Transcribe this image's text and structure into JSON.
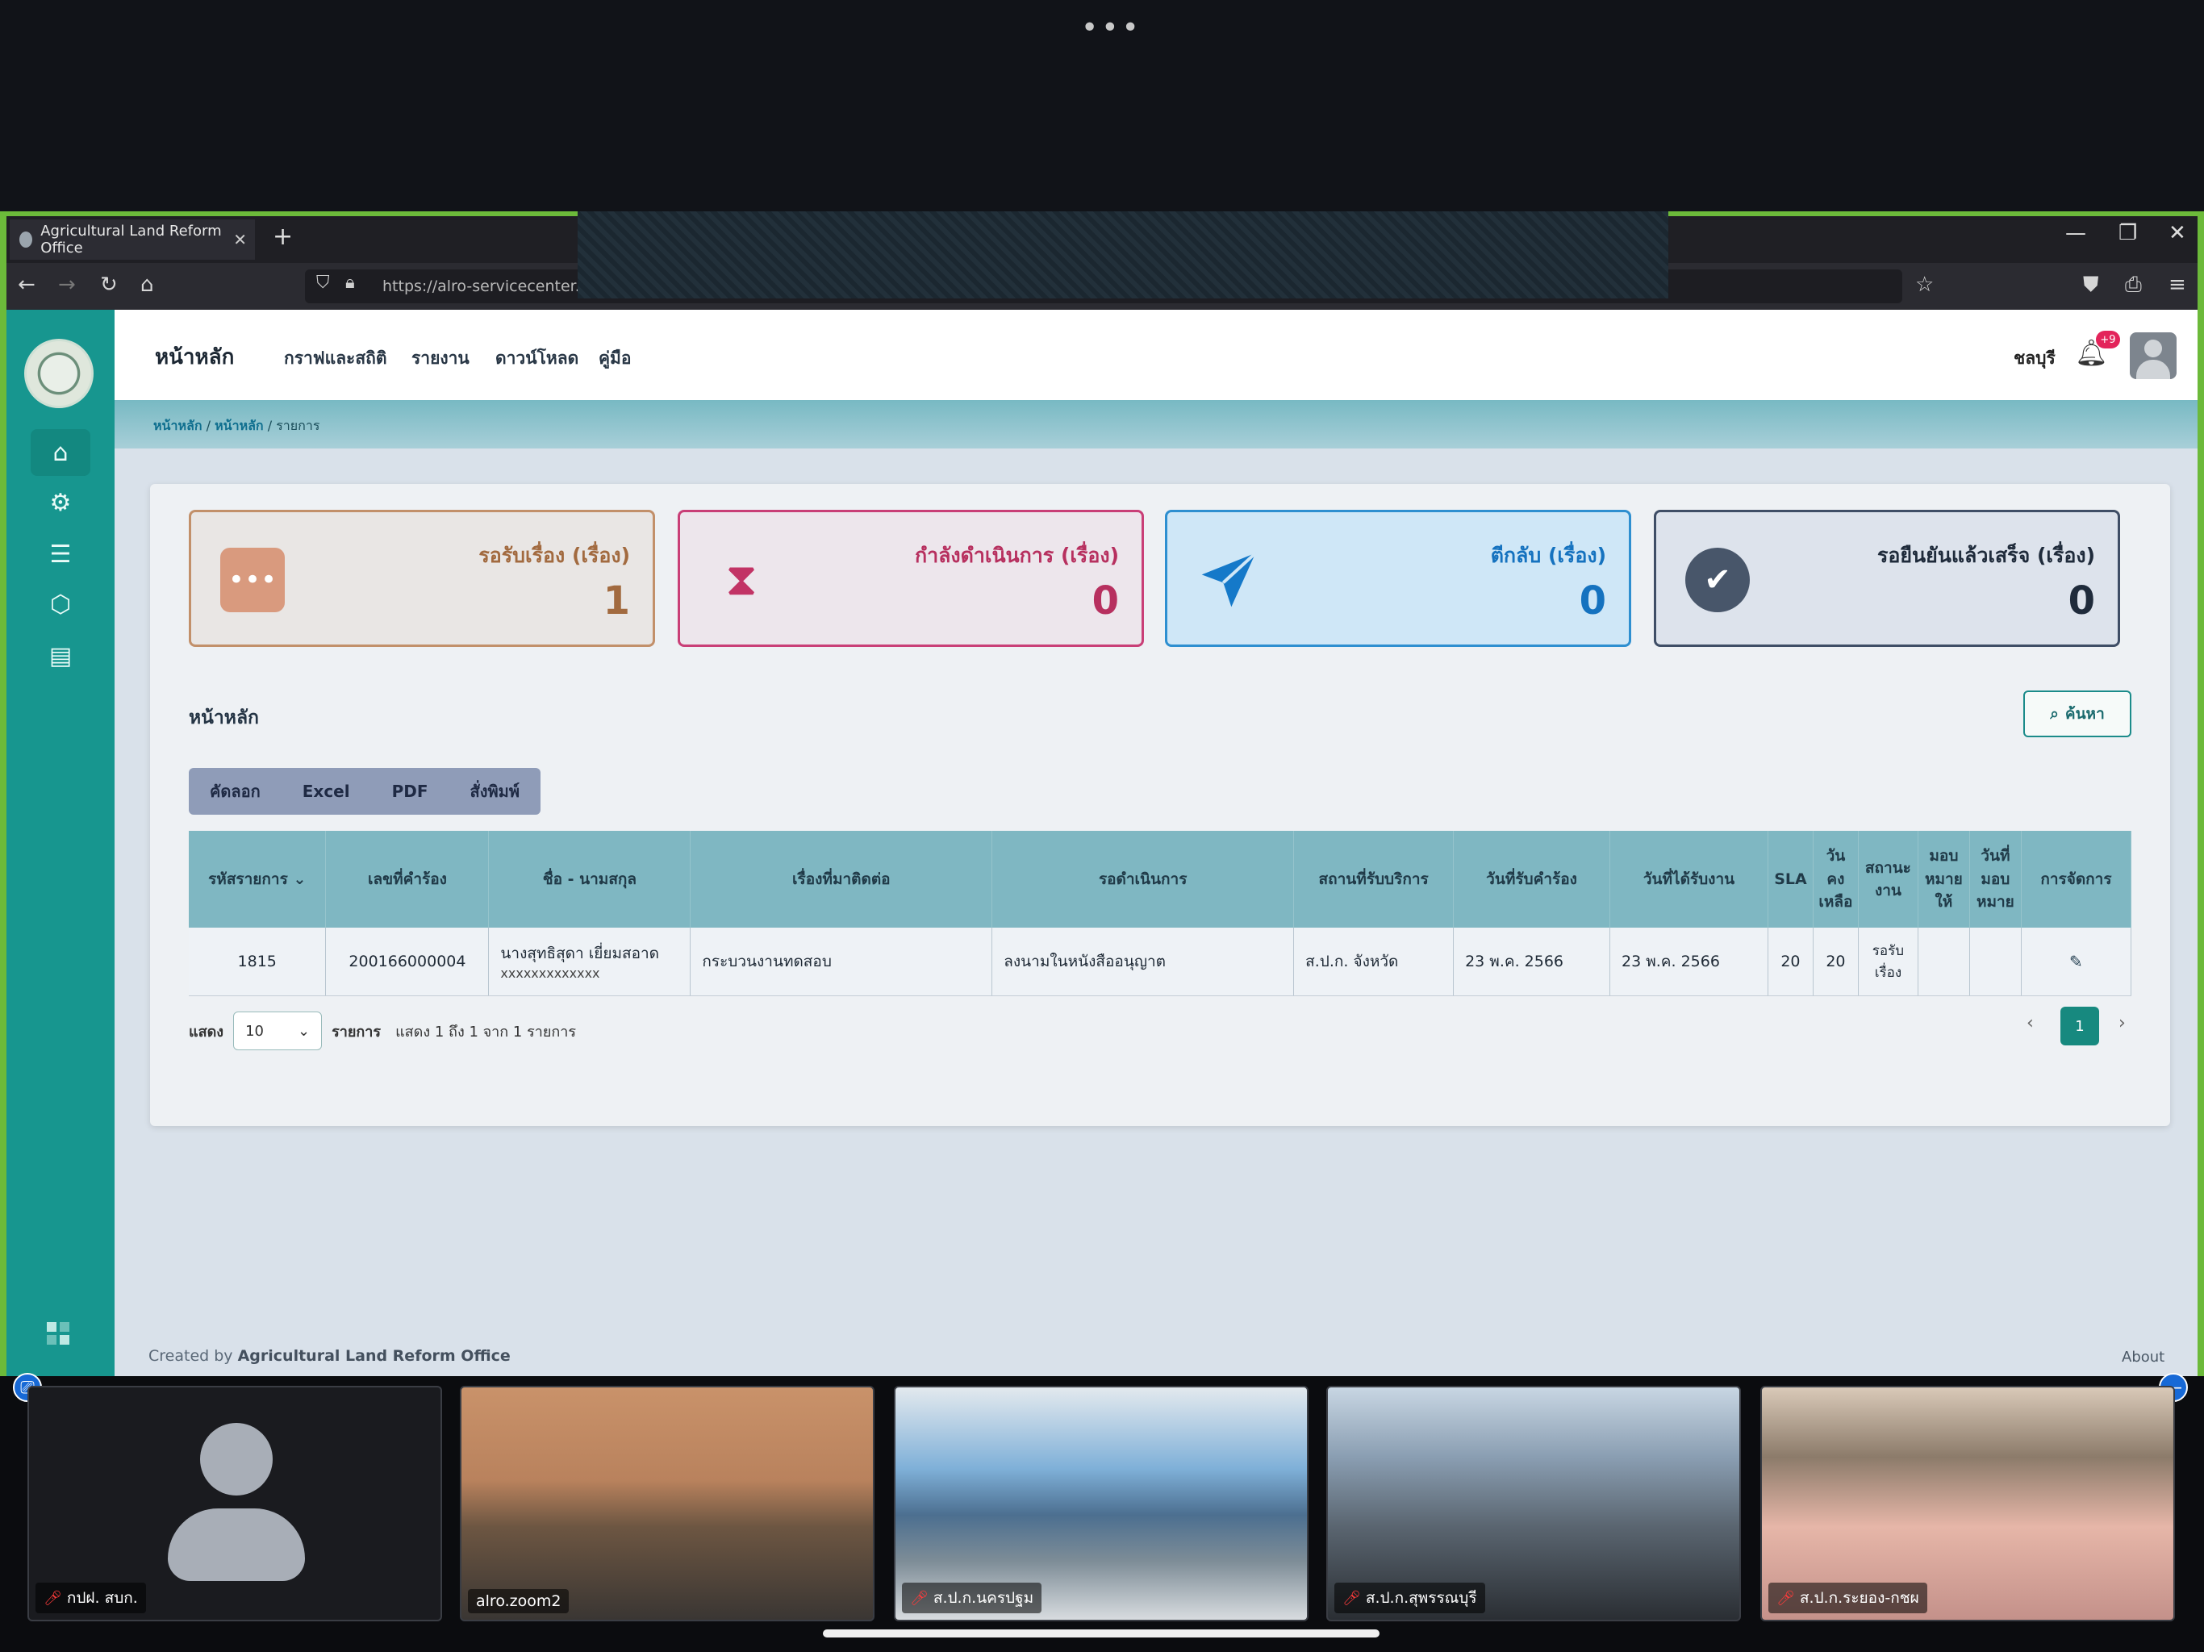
{
  "browser": {
    "tab_title": "Agricultural Land Reform Office",
    "url": "https://alro-servicecenter.alro"
  },
  "header": {
    "brand": "หน้าหลัก",
    "menu": [
      "กราฟและสถิติ",
      "รายงาน",
      "ดาวน์โหลด",
      "คู่มือ"
    ],
    "location": "ชลบุรี",
    "notification_count": "+9"
  },
  "breadcrumb": [
    "หน้าหลัก",
    "หน้าหลัก",
    "รายการ"
  ],
  "stats": [
    {
      "label": "รอรับเรื่อง (เรื่อง)",
      "value": "1",
      "icon": "ellipsis-icon"
    },
    {
      "label": "กำลังดำเนินการ (เรื่อง)",
      "value": "0",
      "icon": "hourglass-icon"
    },
    {
      "label": "ตีกลับ (เรื่อง)",
      "value": "0",
      "icon": "paper-plane-icon"
    },
    {
      "label": "รอยืนยันแล้วเสร็จ (เรื่อง)",
      "value": "0",
      "icon": "check-circle-icon"
    }
  ],
  "section_title": "หน้าหลัก",
  "search_label": "ค้นหา",
  "export_buttons": [
    "คัดลอก",
    "Excel",
    "PDF",
    "สั่งพิมพ์"
  ],
  "table": {
    "headers": [
      "รหัสรายการ",
      "เลขที่คำร้อง",
      "ชื่อ - นามสกุล",
      "เรื่องที่มาติดต่อ",
      "รอดำเนินการ",
      "สถานที่รับบริการ",
      "วันที่รับคำร้อง",
      "วันที่ได้รับงาน",
      "SLA",
      "วัน คง เหลือ",
      "สถานะ งาน",
      "มอบ หมาย ให้",
      "วันที่ มอบ หมาย",
      "การจัดการ"
    ],
    "rows": [
      {
        "id": "1815",
        "request_no": "200166000004",
        "name": "นางสุทธิสุดา เยี่ยมสอาด",
        "name_sub": "xxxxxxxxxxxxx",
        "subject": "กระบวนงานทดสอบ",
        "pending": "ลงนามในหนังสืออนุญาต",
        "place": "ส.ป.ก. จังหวัด",
        "received": "23 พ.ค. 2566",
        "assigned_date": "23 พ.ค. 2566",
        "sla": "20",
        "days_left": "20",
        "status": "รอรับ เรื่อง",
        "assigned_to": "",
        "assigned_on": ""
      }
    ]
  },
  "pager": {
    "show_label": "แสดง",
    "page_size": "10",
    "items_label": "รายการ",
    "summary": "แสดง 1 ถึง 1 จาก 1 รายการ",
    "current_page": "1",
    "prev": "‹",
    "next": "›"
  },
  "footer": {
    "created_by": "Created by",
    "org": "Agricultural Land Reform Office",
    "about": "About"
  },
  "participants": [
    {
      "name": "กปฝ. สบก.",
      "muted": true
    },
    {
      "name": "alro.zoom2",
      "muted": false
    },
    {
      "name": "ส.ป.ก.นครปฐม",
      "muted": true
    },
    {
      "name": "ส.ป.ก.สุพรรณบุรี",
      "muted": true
    },
    {
      "name": "ส.ป.ก.ระยอง-กชผ",
      "muted": true
    }
  ]
}
